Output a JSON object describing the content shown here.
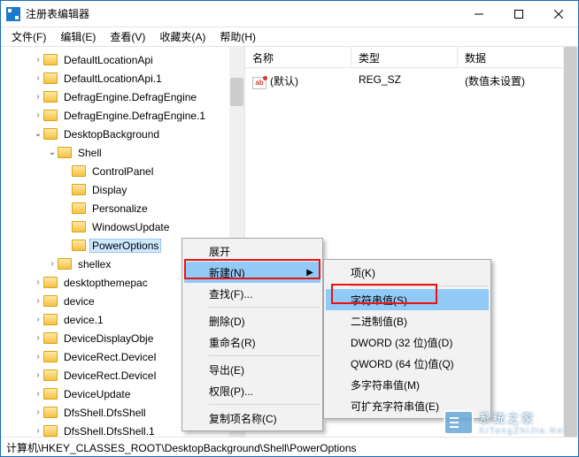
{
  "window": {
    "title": "注册表编辑器"
  },
  "menu": {
    "file": "文件(F)",
    "edit": "编辑(E)",
    "view": "查看(V)",
    "fav": "收藏夹(A)",
    "help": "帮助(H)"
  },
  "tree": {
    "items": [
      {
        "indent": 2,
        "exp": "c",
        "label": "DefaultLocationApi"
      },
      {
        "indent": 2,
        "exp": "c",
        "label": "DefaultLocationApi.1"
      },
      {
        "indent": 2,
        "exp": "c",
        "label": "DefragEngine.DefragEngine"
      },
      {
        "indent": 2,
        "exp": "c",
        "label": "DefragEngine.DefragEngine.1"
      },
      {
        "indent": 2,
        "exp": "o",
        "label": "DesktopBackground"
      },
      {
        "indent": 3,
        "exp": "o",
        "label": "Shell"
      },
      {
        "indent": 4,
        "exp": "n",
        "label": "ControlPanel"
      },
      {
        "indent": 4,
        "exp": "n",
        "label": "Display"
      },
      {
        "indent": 4,
        "exp": "n",
        "label": "Personalize"
      },
      {
        "indent": 4,
        "exp": "n",
        "label": "WindowsUpdate"
      },
      {
        "indent": 4,
        "exp": "n",
        "label": "PowerOptions",
        "selected": true
      },
      {
        "indent": 3,
        "exp": "c",
        "label": "shellex"
      },
      {
        "indent": 2,
        "exp": "c",
        "label": "desktopthemepac"
      },
      {
        "indent": 2,
        "exp": "c",
        "label": "device"
      },
      {
        "indent": 2,
        "exp": "c",
        "label": "device.1"
      },
      {
        "indent": 2,
        "exp": "c",
        "label": "DeviceDisplayObje"
      },
      {
        "indent": 2,
        "exp": "c",
        "label": "DeviceRect.DeviceI"
      },
      {
        "indent": 2,
        "exp": "c",
        "label": "DeviceRect.DeviceI"
      },
      {
        "indent": 2,
        "exp": "c",
        "label": "DeviceUpdate"
      },
      {
        "indent": 2,
        "exp": "c",
        "label": "DfsShell.DfsShell"
      },
      {
        "indent": 2,
        "exp": "c",
        "label": "DfsShell.DfsShell.1"
      }
    ]
  },
  "list": {
    "cols": {
      "name": "名称",
      "type": "类型",
      "data": "数据"
    },
    "row": {
      "name": "(默认)",
      "type": "REG_SZ",
      "data": "(数值未设置)"
    },
    "ab": "ab"
  },
  "ctx1": {
    "expand": "展开",
    "new": "新建(N)",
    "find": "查找(F)...",
    "delete": "删除(D)",
    "rename": "重命名(R)",
    "export": "导出(E)",
    "perm": "权限(P)...",
    "copykey": "复制项名称(C)"
  },
  "ctx2": {
    "key": "项(K)",
    "string": "字符串值(S)",
    "binary": "二进制值(B)",
    "dword": "DWORD (32 位)值(D)",
    "qword": "QWORD (64 位)值(Q)",
    "multi": "多字符串值(M)",
    "expand": "可扩充字符串值(E)"
  },
  "status": {
    "path": "计算机\\HKEY_CLASSES_ROOT\\DesktopBackground\\Shell\\PowerOptions"
  },
  "watermark": {
    "brand": "系统之家",
    "sub": "XiTongZhiJia.Net"
  }
}
